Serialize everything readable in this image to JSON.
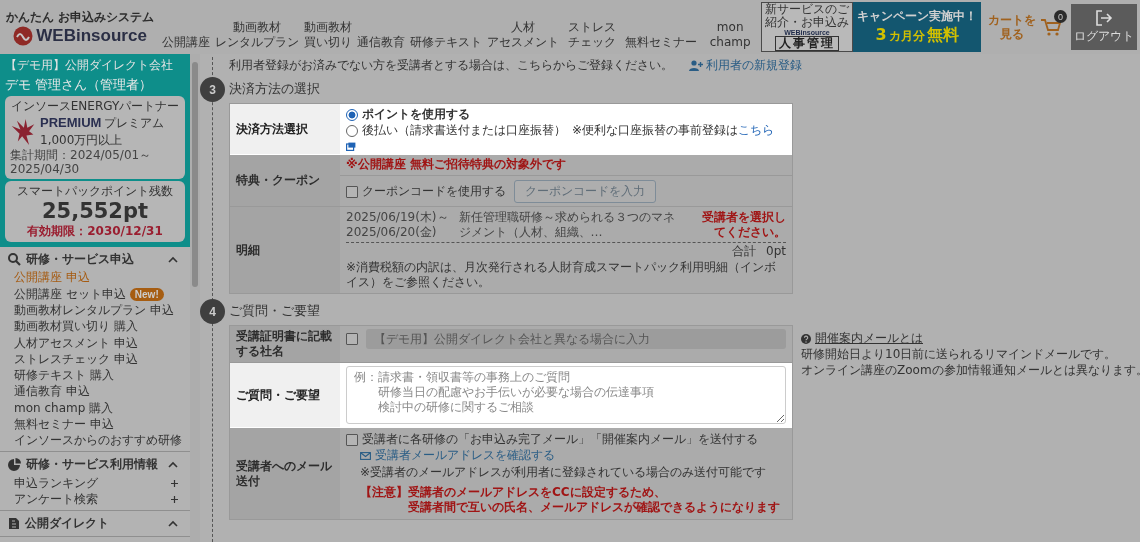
{
  "header": {
    "tagline": "かんたん お申込みシステム",
    "logo": "WEBinsource",
    "nav": [
      [
        "公開講座"
      ],
      [
        "動画教材",
        "レンタルプラン"
      ],
      [
        "動画教材",
        "買い切り"
      ],
      [
        "通信教育"
      ],
      [
        "研修テキスト"
      ],
      [
        "人材",
        "アセスメント"
      ],
      [
        "ストレスチェック"
      ],
      [
        "無料セミナー"
      ],
      [
        "mon champ"
      ]
    ],
    "promo": {
      "caption": "新サービスのご紹介・お申込み",
      "brand": "WEBinsource",
      "product": "人事管理"
    },
    "campaign": {
      "headline": "キャンペーン実施中！",
      "number": "3",
      "unit": "カ月分",
      "offer": "無料"
    },
    "cart": {
      "label": "カートを見る",
      "count": "0"
    },
    "logout": "ログアウト"
  },
  "sidebar": {
    "company": "【デモ用】公開ダイレクト会社",
    "user": "デモ 管理さん（管理者）",
    "partner": {
      "title": "インソースENERGYパートナー",
      "rank": "PREMIUM",
      "rank_kana": "プレミアム",
      "amount": "1,000万円以上",
      "period": "集計期間：2024/05/01～2025/04/30"
    },
    "points": {
      "label": "スマートパックポイント残数",
      "value": "25,552pt",
      "expiry": "有効期限：2030/12/31"
    },
    "sections": [
      {
        "title": "研修・サービス申込",
        "expanded": true,
        "items": [
          {
            "label": "公開講座 申込",
            "selected": true
          },
          {
            "label": "公開講座 セット申込",
            "selected": false,
            "badge": "New!"
          },
          {
            "label": "動画教材レンタルプラン 申込",
            "selected": false
          },
          {
            "label": "動画教材買い切り 購入",
            "selected": false
          },
          {
            "label": "人材アセスメント 申込",
            "selected": false
          },
          {
            "label": "ストレスチェック 申込",
            "selected": false
          },
          {
            "label": "研修テキスト 購入",
            "selected": false
          },
          {
            "label": "通信教育 申込",
            "selected": false
          },
          {
            "label": "mon champ 購入",
            "selected": false
          },
          {
            "label": "無料セミナー 申込",
            "selected": false
          },
          {
            "label": "インソースからのおすすめ研修",
            "selected": false
          }
        ]
      },
      {
        "title": "研修・サービス利用情報",
        "expanded": true,
        "items": [
          {
            "label": "申込ランキング",
            "selected": false,
            "expandable": true
          },
          {
            "label": "アンケート検索",
            "selected": false,
            "expandable": true
          }
        ]
      },
      {
        "title": "公開ダイレクト",
        "expanded": true
      }
    ]
  },
  "intro": {
    "text": "利用者登録がお済みでない方を受講者とする場合は、こちらからご登録ください。",
    "link": "利用者の新規登録"
  },
  "steps": [
    {
      "number": "3",
      "title": "決済方法の選択",
      "rows": [
        {
          "kind": "radios",
          "label": "決済方法選択",
          "highlighted": true,
          "options": [
            {
              "label": "ポイントを使用する",
              "selected": true
            },
            {
              "label": "後払い（請求書送付または口座振替）",
              "selected": false,
              "note": "※便利な口座振替の事前登録は",
              "link": "こちら"
            }
          ]
        },
        {
          "kind": "coupon",
          "label": "特典・クーポン",
          "highlighted": false,
          "notice": "※公開講座 無料ご招待特典の対象外です",
          "checkbox": {
            "label": "クーポンコードを使用する",
            "checked": false
          },
          "button": {
            "label": "クーポンコードを入力",
            "disabled": true
          }
        },
        {
          "kind": "detail",
          "label": "明細",
          "highlighted": false,
          "dates": [
            "2025/06/19(木)～",
            "2025/06/20(金)"
          ],
          "course": "新任管理職研修～求められる３つのマネジメント（人材、組織、…",
          "warning": "受講者を選択してください。",
          "total_label": "合計",
          "total": "0pt",
          "note": "※消費税額の内訳は、月次発行される人財育成スマートパック利用明細（インボイス）をご参照ください。"
        }
      ]
    },
    {
      "number": "4",
      "title": "ご質問・ご要望",
      "rows": [
        {
          "kind": "company",
          "label": "受講証明書に記載する社名",
          "highlighted": false,
          "checked": false,
          "placeholder": "【デモ用】公開ダイレクト会社と異なる場合に入力",
          "disabled": true
        },
        {
          "kind": "textarea",
          "label": "ご質問・ご要望",
          "highlighted": true,
          "placeholder": [
            "例：請求書・領収書等の事務上のご質問",
            "　　研修当日の配慮やお手伝いが必要な場合の伝達事項",
            "　　検討中の研修に関するご相談"
          ]
        },
        {
          "kind": "mail",
          "label": "受講者へのメール送付",
          "highlighted": false,
          "checkbox": {
            "label": "受講者に各研修の「お申込み完了メール」「開催案内メール」を送付する",
            "checked": false
          },
          "link": "受講者メールアドレスを確認する",
          "note": "※受講者のメールアドレスが利用者に登録されている場合のみ送付可能です",
          "caution_label": "【注意】",
          "caution": [
            "受講者のメールアドレスをCCに設定するため、",
            "受講者間で互いの氏名、メールアドレスが確認できるようになります"
          ]
        }
      ],
      "side_note": {
        "title": "開催案内メールとは",
        "lines": [
          "研修開始日より10日前に送られるリマインドメールです。",
          "オンライン講座のZoomの参加情報通知メールとは異なります。"
        ]
      }
    }
  ]
}
